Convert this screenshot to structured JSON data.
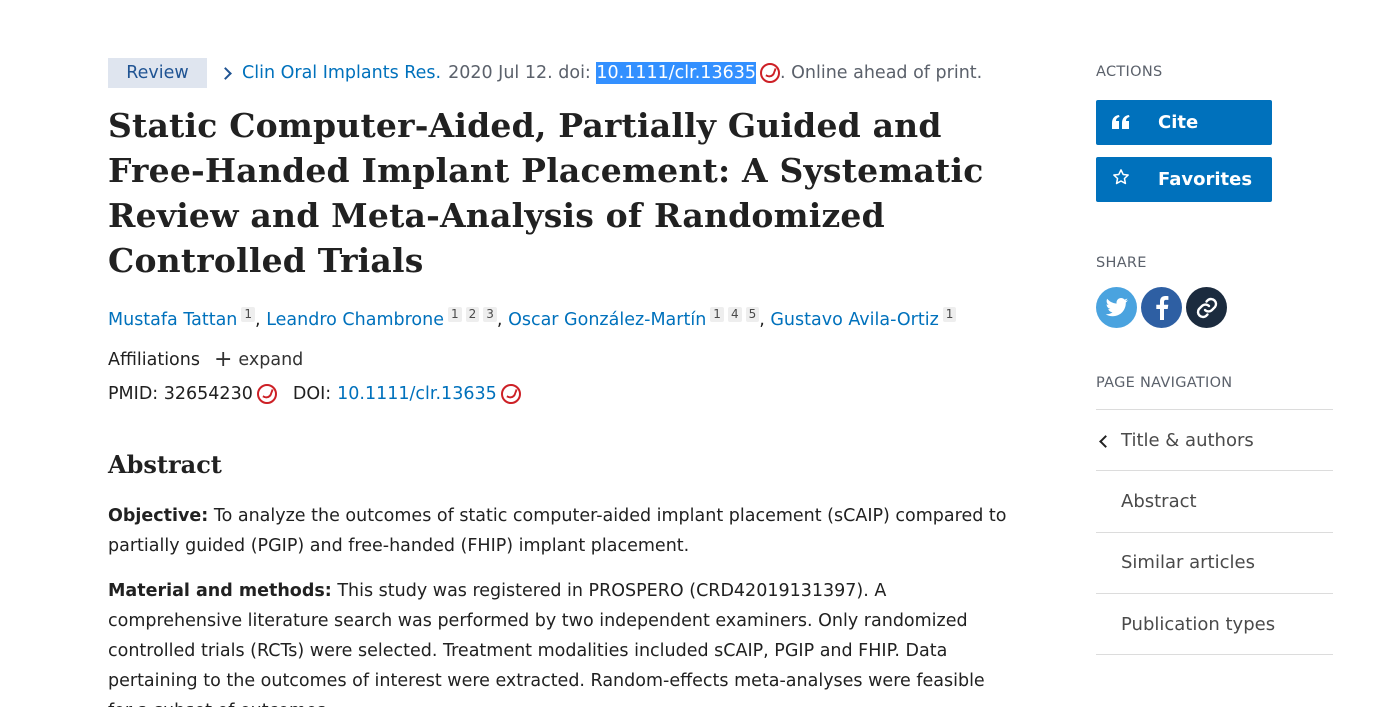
{
  "citation": {
    "badge": "Review",
    "journal": "Clin Oral Implants Res.",
    "date_doi_prefix": "2020 Jul 12. doi:",
    "doi": "10.1111/clr.13635",
    "suffix": ". Online ahead of print."
  },
  "title": "Static Computer-Aided, Partially Guided and Free-Handed Implant Placement: A Systematic Review and Meta-Analysis of Randomized Controlled Trials",
  "authors": [
    {
      "name": "Mustafa Tattan",
      "affs": [
        "1"
      ]
    },
    {
      "name": "Leandro Chambrone",
      "affs": [
        "1",
        "2",
        "3"
      ]
    },
    {
      "name": "Oscar González-Martín",
      "affs": [
        "1",
        "4",
        "5"
      ]
    },
    {
      "name": "Gustavo Avila-Ortiz",
      "affs": [
        "1"
      ]
    }
  ],
  "separator": ",",
  "affiliations": {
    "label": "Affiliations",
    "expand": "expand"
  },
  "ids": {
    "pmid_label": "PMID:",
    "pmid": "32654230",
    "doi_label": "DOI:",
    "doi": "10.1111/clr.13635"
  },
  "abstract": {
    "heading": "Abstract",
    "paragraphs": [
      {
        "label": "Objective:",
        "text": " To analyze the outcomes of static computer-aided implant placement (sCAIP) compared to partially guided (PGIP) and free-handed (FHIP) implant placement."
      },
      {
        "label": "Material and methods:",
        "text": " This study was registered in PROSPERO (CRD42019131397). A comprehensive literature search was performed by two independent examiners. Only randomized controlled trials (RCTs) were selected. Treatment modalities included sCAIP, PGIP and FHIP. Data pertaining to the outcomes of interest were extracted. Random-effects meta-analyses were feasible for a subset of outcomes."
      }
    ]
  },
  "sidebar": {
    "actions_label": "ACTIONS",
    "cite_label": "Cite",
    "favorites_label": "Favorites",
    "share_label": "SHARE",
    "nav_label": "PAGE NAVIGATION",
    "nav_items": [
      "Title & authors",
      "Abstract",
      "Similar articles",
      "Publication types"
    ]
  },
  "icons": {
    "cite": "quote-icon",
    "favorites": "star-icon",
    "twitter": "twitter-icon",
    "facebook": "facebook-icon",
    "permalink": "link-icon",
    "external": "external-link-icon"
  },
  "colors": {
    "link": "#0071bc",
    "button": "#0071bc",
    "badge_bg": "#dfe5ef",
    "doi_highlight": "#3390ff",
    "twitter": "#4aa3df",
    "facebook": "#2e5fa3",
    "permalink": "#1b2b3e"
  }
}
